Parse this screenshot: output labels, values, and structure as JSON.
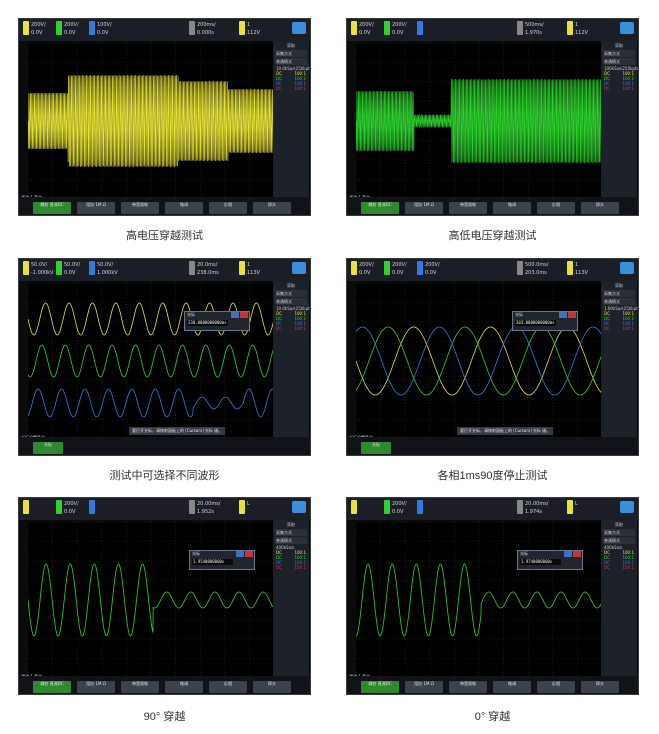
{
  "captions": [
    "高电压穿越测试",
    "高低电压穿越测试",
    "测试中可选择不同波形",
    "各相1ms90度停止测试",
    "90° 穿越",
    "0° 穿越"
  ],
  "colors": {
    "ch1": "#e8e33a",
    "ch2": "#2fd12f",
    "ch3": "#2f7be0",
    "ch4": "#d0344a",
    "softkey": "#3b414d",
    "softkey_active": "#2f8a2f"
  },
  "panels": [
    {
      "top": {
        "ch1": "200V/",
        "ch1b": "0.0V",
        "ch2": "200V/",
        "ch2b": "0.0V",
        "ch3": "100V/",
        "ch3b": "0.0V",
        "tb": "200ms/",
        "tb2": "0.000s",
        "trig": "1",
        "trigv": "112V"
      },
      "side": {
        "hdr": "获取",
        "mode": "采集方式",
        "m2": "普通模式",
        "rate": "10.0kSa/s",
        "pts": "250kpts",
        "ch": [
          "DC",
          "DC",
          "DC",
          "DC"
        ],
        "ratio": [
          "100:1",
          "100:1",
          "100:1",
          "100:1"
        ]
      },
      "status": "通道 1 菜单",
      "keys": [
        "耦合 直流DC",
        "阻抗 1M Ω",
        "带宽限制",
        "微调",
        "反相",
        "探头"
      ]
    },
    {
      "top": {
        "ch1": "200V/",
        "ch1b": "0.0V",
        "ch2": "200V/",
        "ch2b": "0.0V",
        "ch3": "",
        "ch3b": "",
        "tb": "500ms/",
        "tb2": "1.970s",
        "trig": "1",
        "trigv": "112V"
      },
      "side": {
        "hdr": "获取",
        "mode": "采集方式",
        "m2": "普通模式",
        "rate": "100kSa/s",
        "pts": "250kpts",
        "ch": [
          "DC",
          "DC",
          "DC",
          "DC"
        ],
        "ratio": [
          "100:1",
          "100:1",
          "100:1",
          "100:1"
        ]
      },
      "status": "通道 1 菜单",
      "keys": [
        "耦合 直流DC",
        "阻抗 1M Ω",
        "带宽限制",
        "微调",
        "反相",
        "探头"
      ],
      "state": "停止"
    },
    {
      "top": {
        "ch1": "50.0V/",
        "ch1b": "-1.000kV",
        "ch2": "50.0V/",
        "ch2b": "0.0V",
        "ch3": "50.0V/",
        "ch3b": "1.000kV",
        "tb": "20.0ms/",
        "tb2": "238.0ms",
        "trig": "1",
        "trigv": "113V"
      },
      "side": {
        "hdr": "获取",
        "mode": "采集方式",
        "m2": "普通模式",
        "rate": "10.0kSa/s",
        "pts": "250kpts",
        "ch": [
          "DC",
          "DC",
          "DC",
          "DC"
        ],
        "ratio": [
          "100:1",
          "100:1",
          "100:1",
          "100:1"
        ]
      },
      "popup": {
        "t": "光标",
        "v": "238.0000000000ms"
      },
      "status": "光标设置菜单",
      "msg": "要打开光标，请按前面板上的 [Cursors] 光标 键。",
      "keys": [
        "光标"
      ],
      "state": "停止"
    },
    {
      "top": {
        "ch1": "200V/",
        "ch1b": "0.0V",
        "ch2": "200V/",
        "ch2b": "0.0V",
        "ch3": "200V/",
        "ch3b": "0.0V",
        "tb": "500.0ms/",
        "tb2": "203.0ms",
        "trig": "1",
        "trigv": "113V"
      },
      "side": {
        "hdr": "获取",
        "mode": "采集方式",
        "m2": "普通模式",
        "rate": "1.00kSa/s",
        "pts": "250kpts",
        "ch": [
          "DC",
          "DC",
          "DC",
          "DC"
        ],
        "ratio": [
          "100:1",
          "100:1",
          "100:1",
          "100:1"
        ]
      },
      "popup": {
        "t": "光标",
        "v": "203.0000000000ms"
      },
      "status": "光标设置菜单",
      "msg": "要打开光标，请按前面板上的 [Cursors] 光标 键。",
      "keys": [
        "光标"
      ],
      "state": "停止"
    },
    {
      "top": {
        "ch1": "",
        "ch1b": "",
        "ch2": "200V/",
        "ch2b": "0.0V",
        "ch3": "",
        "ch3b": "",
        "tb": "20.00ms/",
        "tb2": "1.952s",
        "trig": "",
        "trigv": "L"
      },
      "side": {
        "hdr": "获取",
        "mode": "采集方式",
        "m2": "普通模式",
        "rate": "400kSa/s",
        "pts": "",
        "ch": [
          "DC",
          "DC",
          "DC",
          "DC"
        ],
        "ratio": [
          "100:1",
          "100:1",
          "100:1",
          "100:1"
        ]
      },
      "popup": {
        "t": "光标",
        "v": "1.9540000000s"
      },
      "status": "通道 1 菜单",
      "keys": [
        "耦合 直流DC",
        "阻抗 1M Ω",
        "带宽限制",
        "微调",
        "反相",
        "探头"
      ]
    },
    {
      "top": {
        "ch1": "",
        "ch1b": "",
        "ch2": "200V/",
        "ch2b": "0.0V",
        "ch3": "",
        "ch3b": "",
        "tb": "20.00ms/",
        "tb2": "1.974s",
        "trig": "",
        "trigv": "L"
      },
      "side": {
        "hdr": "获取",
        "mode": "采集方式",
        "m2": "普通模式",
        "rate": "400kSa/s",
        "pts": "",
        "ch": [
          "DC",
          "DC",
          "DC",
          "DC"
        ],
        "ratio": [
          "100:1",
          "100:1",
          "100:1",
          "100:1"
        ]
      },
      "popup": {
        "t": "光标",
        "v": "1.9740000000s"
      },
      "status": "通道 1 菜单",
      "keys": [
        "耦合 直流DC",
        "阻抗 1M Ω",
        "带宽限制",
        "微调",
        "反相",
        "探头"
      ]
    }
  ]
}
